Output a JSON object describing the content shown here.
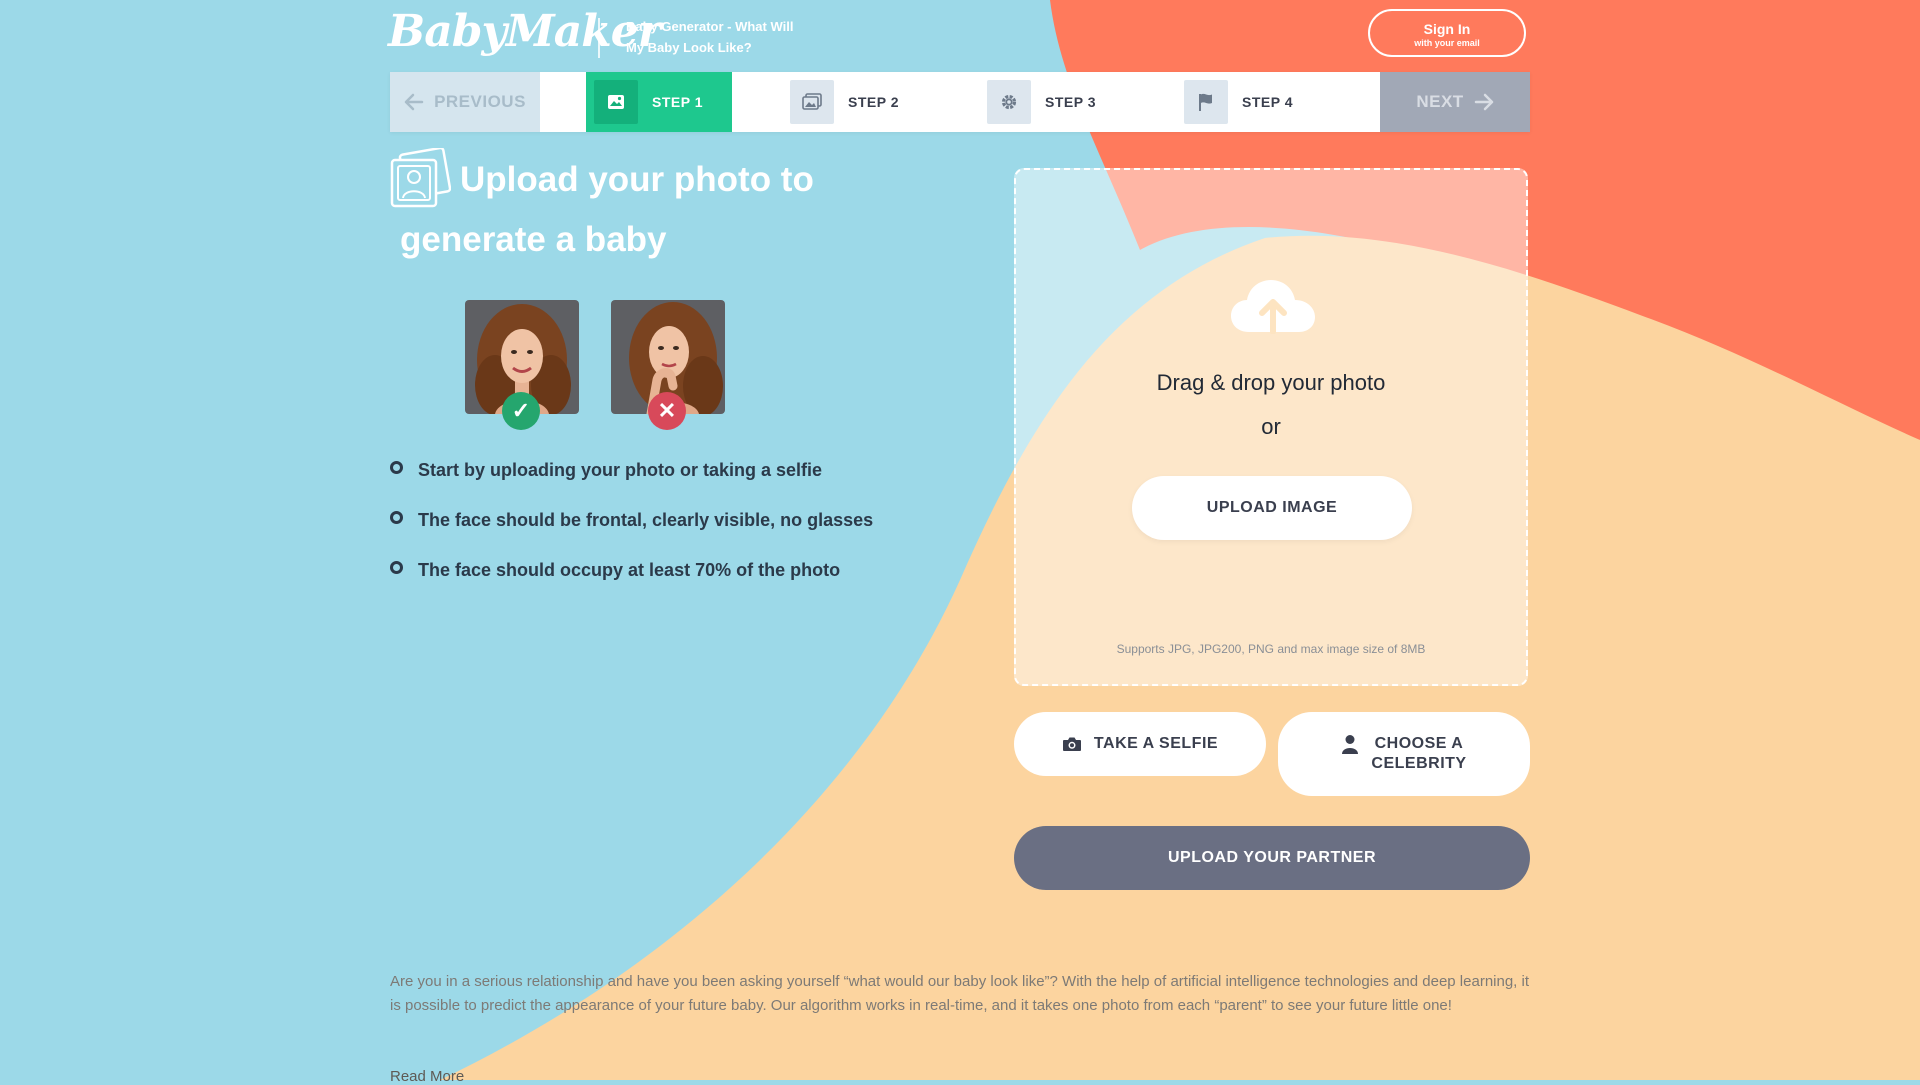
{
  "header": {
    "logo": "BabyMaker",
    "tagline": "Baby Generator - What Will My Baby Look Like?",
    "signin_label": "Sign In",
    "signin_sub": "with your email"
  },
  "steps": {
    "previous_label": "PREVIOUS",
    "next_label": "NEXT",
    "items": [
      {
        "label": "STEP 1",
        "icon": "image-icon",
        "active": true
      },
      {
        "label": "STEP 2",
        "icon": "images-icon",
        "active": false
      },
      {
        "label": "STEP 3",
        "icon": "gear-icon",
        "active": false
      },
      {
        "label": "STEP 4",
        "icon": "flag-icon",
        "active": false
      }
    ]
  },
  "main": {
    "title": "Upload your photo to generate a baby",
    "examples": [
      {
        "status": "good",
        "icon": "check-icon"
      },
      {
        "status": "bad",
        "icon": "x-icon"
      }
    ],
    "tips": [
      "Start by uploading your photo or taking a selfie",
      "The face should be frontal, clearly visible, no glasses",
      "The face should occupy at least 70% of the photo"
    ]
  },
  "upload": {
    "drag_text": "Drag & drop your photo",
    "or_text": "or",
    "upload_label": "UPLOAD IMAGE",
    "supports_text": "Supports JPG, JPG200, PNG and max image size of 8MB",
    "selfie_label": "TAKE A SELFIE",
    "celebrity_label_line1": "CHOOSE A",
    "celebrity_label_line2": "CELEBRITY",
    "partner_label": "UPLOAD YOUR PARTNER"
  },
  "about": {
    "text": "Are you in a serious relationship and have you been asking yourself “what would our baby look like”? With the help of artificial intelligence technologies and deep learning, it is possible to predict the appearance of your future baby. Our algorithm works in real-time, and it takes one photo from each “parent” to see your future little one!",
    "read_more": "Read More"
  },
  "colors": {
    "bg_blue": "#9cd9e8",
    "bg_peach": "#fcd49f",
    "bg_coral": "#ff7a5c",
    "accent_green": "#1ec88e",
    "partner_button": "#6a6f83"
  }
}
